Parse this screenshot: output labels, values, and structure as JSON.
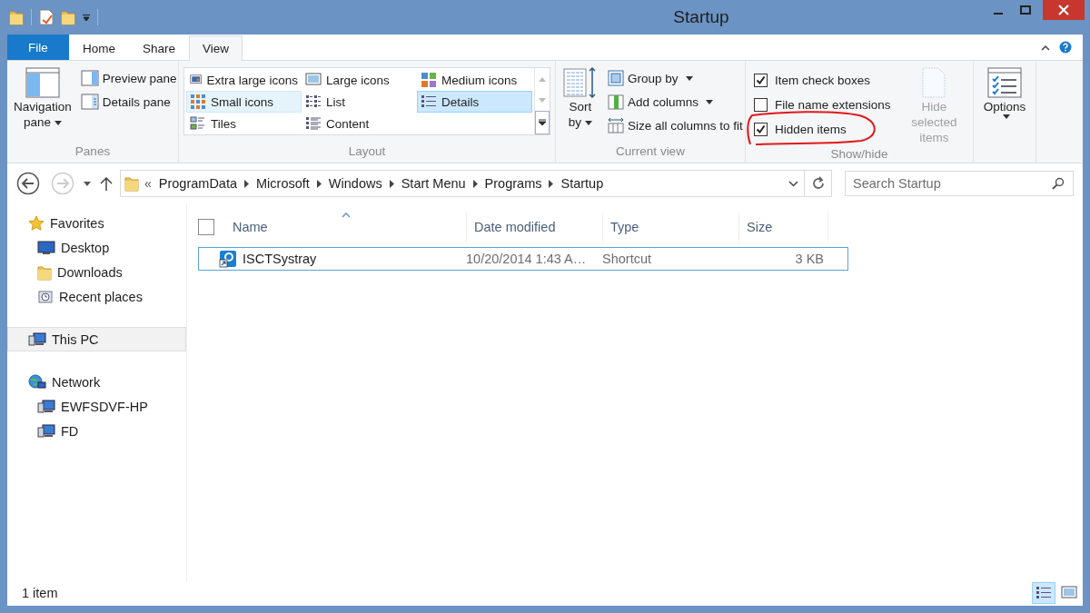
{
  "window": {
    "title": "Startup"
  },
  "tabs": [
    {
      "label": "File",
      "kind": "file",
      "selected": false
    },
    {
      "label": "Home",
      "kind": "tab",
      "selected": false
    },
    {
      "label": "Share",
      "kind": "tab",
      "selected": false
    },
    {
      "label": "View",
      "kind": "tab",
      "selected": true
    }
  ],
  "panes": {
    "group_label": "Panes",
    "navigation_pane": "Navigation pane",
    "preview_pane": "Preview pane",
    "details_pane": "Details pane"
  },
  "layout": {
    "group_label": "Layout",
    "items": [
      {
        "label": "Extra large icons",
        "kind": "xl",
        "selected": false,
        "hovered": false
      },
      {
        "label": "Large icons",
        "kind": "large",
        "selected": false,
        "hovered": false
      },
      {
        "label": "Medium icons",
        "kind": "medium",
        "selected": false,
        "hovered": false
      },
      {
        "label": "Small icons",
        "kind": "small",
        "selected": false,
        "hovered": true
      },
      {
        "label": "List",
        "kind": "list",
        "selected": false,
        "hovered": false
      },
      {
        "label": "Details",
        "kind": "details",
        "selected": true,
        "hovered": false
      },
      {
        "label": "Tiles",
        "kind": "tiles",
        "selected": false,
        "hovered": false
      },
      {
        "label": "Content",
        "kind": "content",
        "selected": false,
        "hovered": false
      }
    ]
  },
  "current_view": {
    "group_label": "Current view",
    "sort_by": "Sort by",
    "group_by": "Group by",
    "add_columns": "Add columns",
    "size_columns": "Size all columns to fit"
  },
  "show_hide": {
    "group_label": "Show/hide",
    "items": [
      {
        "label": "Item check boxes",
        "checked": true
      },
      {
        "label": "File name extensions",
        "checked": false
      },
      {
        "label": "Hidden items",
        "checked": true
      }
    ],
    "hide_selected": {
      "label": "Hide selected items",
      "disabled": true
    }
  },
  "options": {
    "label": "Options"
  },
  "address_bar": {
    "crumbs": [
      "ProgramData",
      "Microsoft",
      "Windows",
      "Start Menu",
      "Programs",
      "Startup"
    ],
    "overflow": "«"
  },
  "search": {
    "placeholder": "Search Startup"
  },
  "navigation": [
    {
      "label": "Favorites",
      "kind": "favorites",
      "selected": false,
      "children": [
        {
          "label": "Desktop",
          "kind": "desktop",
          "selected": false
        },
        {
          "label": "Downloads",
          "kind": "downloads",
          "selected": false
        },
        {
          "label": "Recent places",
          "kind": "recent",
          "selected": false
        }
      ]
    },
    {
      "label": "This PC",
      "kind": "pc",
      "selected": true
    },
    {
      "label": "Network",
      "kind": "network",
      "selected": false,
      "children": [
        {
          "label": "EWFSDVF-HP",
          "kind": "computer",
          "selected": false
        },
        {
          "label": "FD",
          "kind": "computer",
          "selected": false
        }
      ]
    }
  ],
  "table": {
    "select_all": {
      "checked": false
    },
    "columns": [
      {
        "label": "Name",
        "sorted": true
      },
      {
        "label": "Date modified",
        "sorted": false
      },
      {
        "label": "Type",
        "sorted": false
      },
      {
        "label": "Size",
        "sorted": false
      }
    ],
    "rows": [
      {
        "name": "ISCTSystray",
        "date_modified": "10/20/2014 1:43 A…",
        "type": "Shortcut",
        "size": "3 KB",
        "selected": true
      }
    ]
  },
  "status_bar": {
    "text": "1 item",
    "views": [
      {
        "kind": "details",
        "selected": true
      },
      {
        "kind": "large",
        "selected": false
      }
    ]
  }
}
